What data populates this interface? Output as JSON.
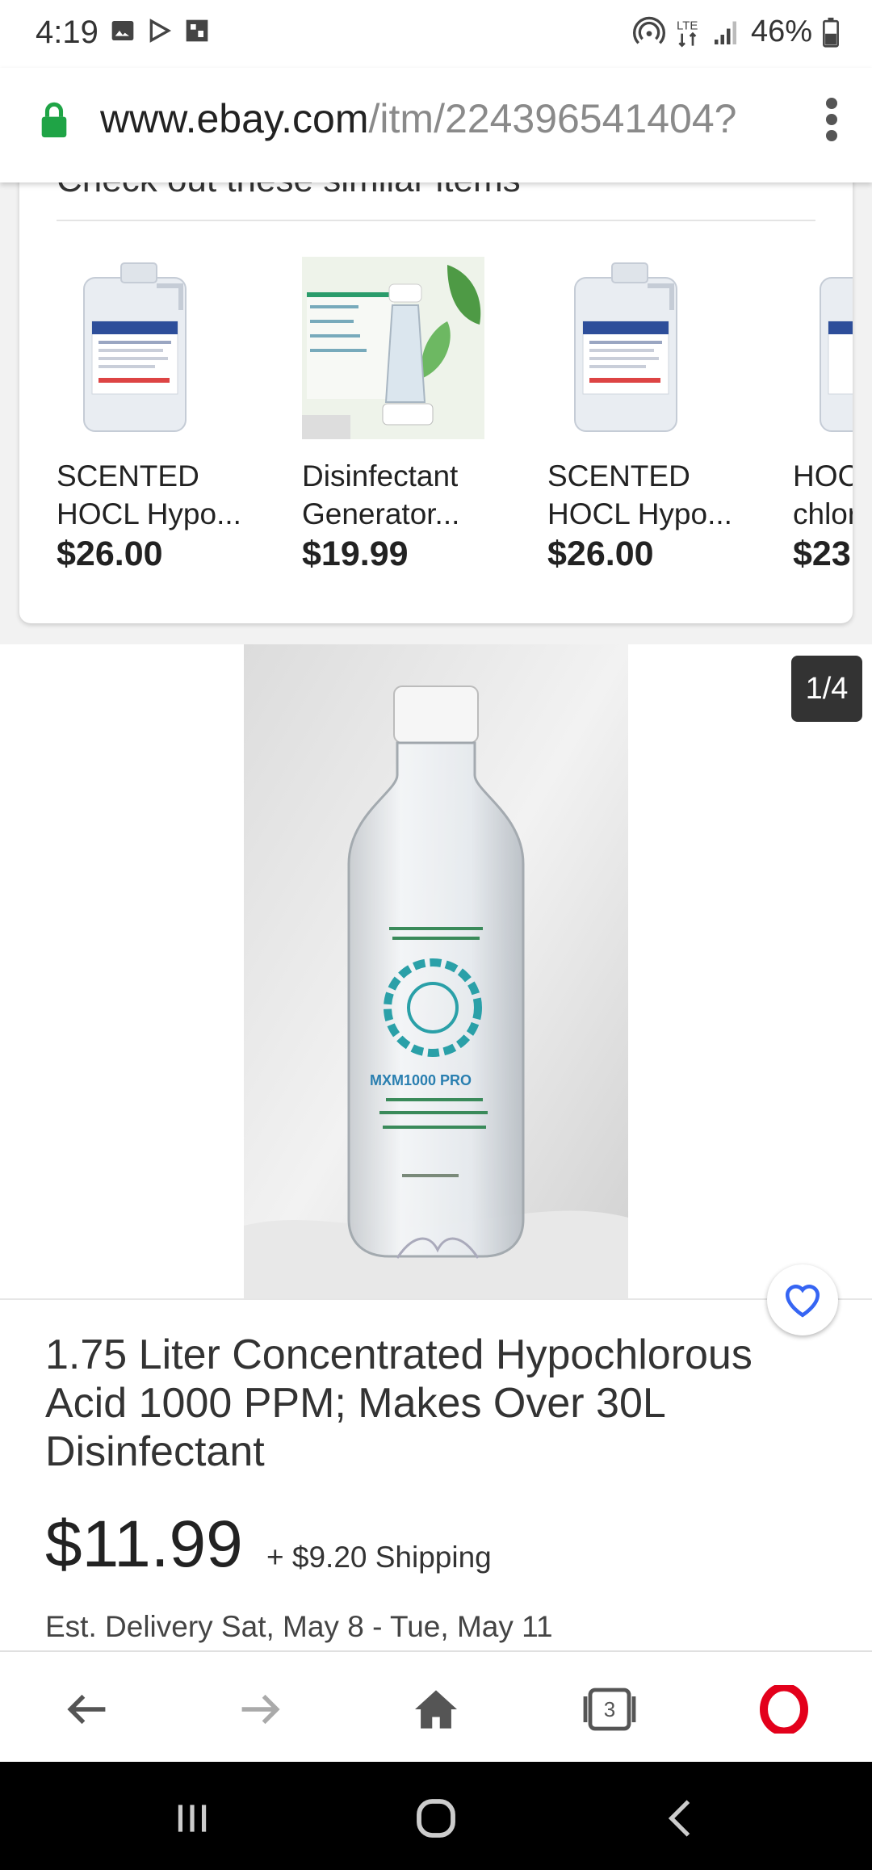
{
  "status": {
    "time": "4:19",
    "battery": "46%"
  },
  "browser": {
    "url_domain": "www.ebay.com",
    "url_path": "/itm/224396541404?",
    "tab_count": "3"
  },
  "similar": {
    "title": "Check out these similar items",
    "items": [
      {
        "line1": "SCENTED",
        "line2": "HOCL Hypo...",
        "price": "$26.00"
      },
      {
        "line1": "Disinfectant",
        "line2": "Generator...",
        "price": "$19.99"
      },
      {
        "line1": "SCENTED",
        "line2": "HOCL Hypo...",
        "price": "$26.00"
      },
      {
        "line1": "HOC",
        "line2": "chlor",
        "price": "$23"
      }
    ]
  },
  "gallery": {
    "counter": "1/4"
  },
  "product": {
    "title": "1.75 Liter Concentrated Hypochlorous Acid 1000 PPM; Makes Over 30L Disinfectant",
    "price": "$11.99",
    "shipping": "+ $9.20 Shipping",
    "delivery": "Est. Delivery Sat, May 8 - Tue, May 11"
  },
  "colors": {
    "ebay_blue": "#3665f3",
    "opera_red": "#e3001b",
    "lock_green": "#1fa446"
  }
}
